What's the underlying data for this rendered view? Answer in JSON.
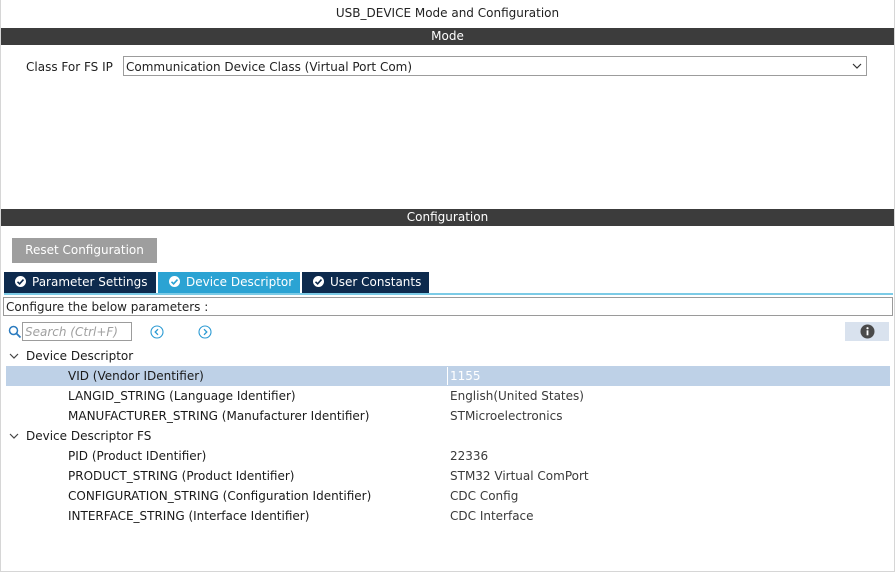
{
  "window": {
    "title": "USB_DEVICE Mode and Configuration"
  },
  "mode_section": {
    "header": "Mode",
    "class_label": "Class For FS IP",
    "class_value": "Communication Device Class (Virtual Port Com)"
  },
  "config_section": {
    "header": "Configuration",
    "reset_button": "Reset Configuration",
    "tabs": [
      {
        "label": "Parameter Settings",
        "active": false
      },
      {
        "label": "Device Descriptor",
        "active": true
      },
      {
        "label": "User Constants",
        "active": false
      }
    ],
    "hint": "Configure the below parameters :",
    "search": {
      "placeholder": "Search (Ctrl+F)",
      "value": ""
    }
  },
  "tree": {
    "group1": {
      "label": "Device Descriptor",
      "params": [
        {
          "name": "VID (Vendor IDentifier)",
          "value": "1155",
          "selected": true
        },
        {
          "name": "LANGID_STRING (Language Identifier)",
          "value": "English(United States)"
        },
        {
          "name": "MANUFACTURER_STRING (Manufacturer Identifier)",
          "value": "STMicroelectronics"
        }
      ]
    },
    "group2": {
      "label": "Device Descriptor FS",
      "params": [
        {
          "name": "PID (Product IDentifier)",
          "value": "22336"
        },
        {
          "name": "PRODUCT_STRING (Product Identifier)",
          "value": "STM32 Virtual ComPort"
        },
        {
          "name": "CONFIGURATION_STRING (Configuration Identifier)",
          "value": "CDC Config"
        },
        {
          "name": "INTERFACE_STRING (Interface Identifier)",
          "value": "CDC Interface"
        }
      ]
    }
  },
  "colors": {
    "header_bar": "#3c3c3c",
    "tab_active": "#2ba3d3",
    "tab_inactive": "#0d2a4d",
    "selected_row": "#bed1e7",
    "reset_button": "#9e9e9e"
  },
  "icons": {
    "dropdown": "chevron-down-icon",
    "tab_check": "check-circle-icon",
    "search": "search-icon",
    "prev": "previous-icon",
    "next": "next-icon",
    "info": "info-icon",
    "expand": "chevron-down-icon"
  }
}
